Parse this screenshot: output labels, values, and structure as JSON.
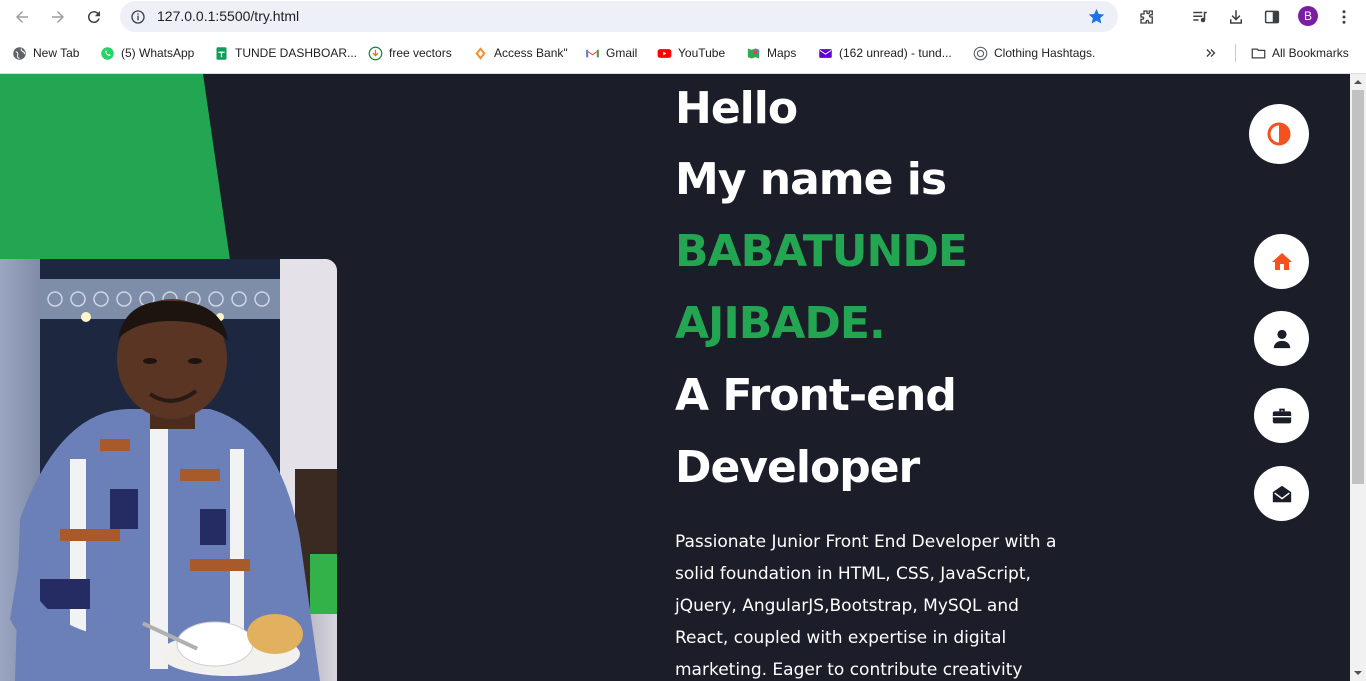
{
  "browser": {
    "url": "127.0.0.1:5500/try.html",
    "profile_initial": "B",
    "bookmarks": [
      {
        "label": "New Tab",
        "icon": "globe-icon"
      },
      {
        "label": "(5) WhatsApp",
        "icon": "whatsapp-icon"
      },
      {
        "label": "TUNDE DASHBOAR...",
        "icon": "sheets-icon"
      },
      {
        "label": "free vectors",
        "icon": "download-circle-icon"
      },
      {
        "label": "Access Bank\"",
        "icon": "access-bank-icon"
      },
      {
        "label": "Gmail",
        "icon": "gmail-icon"
      },
      {
        "label": "YouTube",
        "icon": "youtube-icon"
      },
      {
        "label": "Maps",
        "icon": "maps-icon"
      },
      {
        "label": "(162 unread) - tund...",
        "icon": "yahoo-mail-icon"
      },
      {
        "label": "Clothing Hashtags.",
        "icon": "hashtag-site-icon"
      }
    ],
    "all_bookmarks_label": "All Bookmarks"
  },
  "hero": {
    "line1": "Hello",
    "line2": "My name is",
    "name_first": "BABATUNDE",
    "name_last": "AJIBADE.",
    "role_line1": "A Front-end",
    "role_line2": "Developer",
    "bio": "Passionate Junior Front End Developer with a solid foundation in HTML, CSS, JavaScript, jQuery, AngularJS,Bootstrap, MySQL and React, coupled with expertise in digital marketing. Eager to contribute creativity"
  },
  "colors": {
    "accent_green": "#22a652",
    "accent_orange": "#f4511e",
    "background": "#1b1d29"
  },
  "side_nav": [
    {
      "icon": "home-icon"
    },
    {
      "icon": "user-icon"
    },
    {
      "icon": "briefcase-icon"
    },
    {
      "icon": "envelope-open-icon"
    }
  ]
}
